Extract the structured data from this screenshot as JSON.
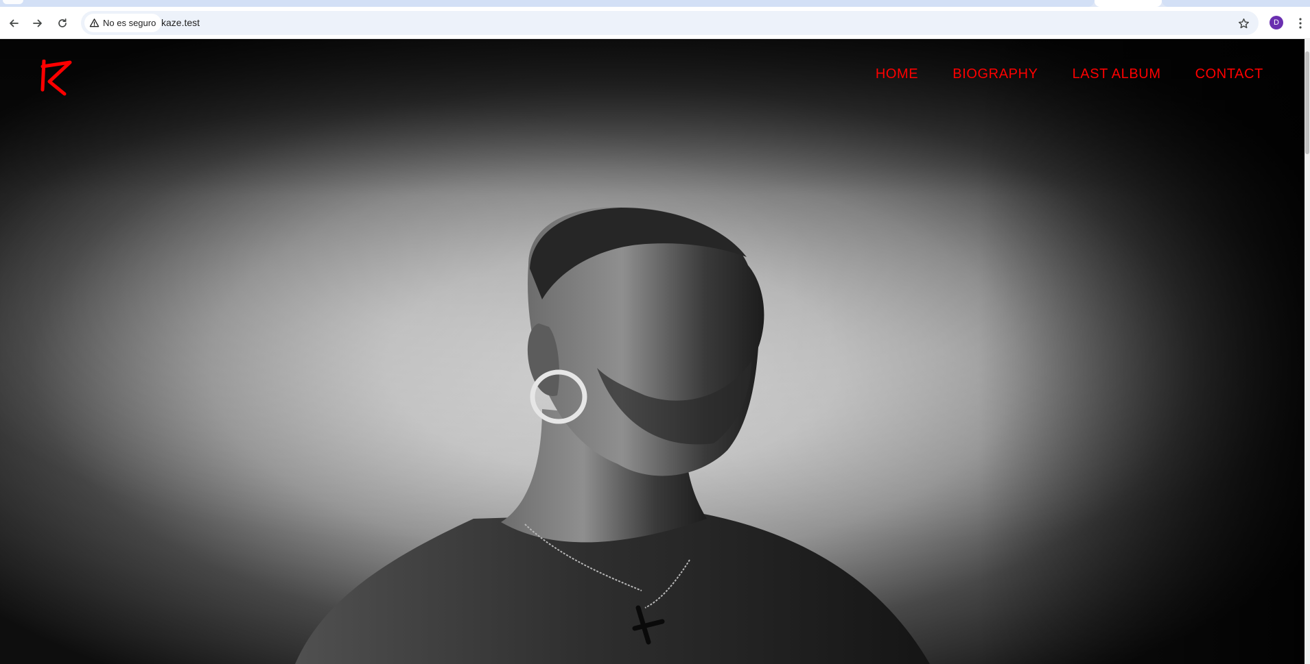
{
  "browser": {
    "security_label": "No es seguro",
    "url": "kaze.test",
    "profile_initial": "D"
  },
  "site": {
    "nav": [
      {
        "label": "HOME"
      },
      {
        "label": "BIOGRAPHY"
      },
      {
        "label": "LAST ALBUM"
      },
      {
        "label": "CONTACT"
      }
    ]
  },
  "colors": {
    "accent": "#ff0000",
    "profile": "#6a2fb0",
    "omnibox": "#edf2fa"
  },
  "icons": {
    "back": "arrow-left-icon",
    "forward": "arrow-right-icon",
    "reload": "reload-icon",
    "warning": "warning-triangle-icon",
    "bookmark": "star-icon",
    "menu": "kebab-menu-icon"
  }
}
